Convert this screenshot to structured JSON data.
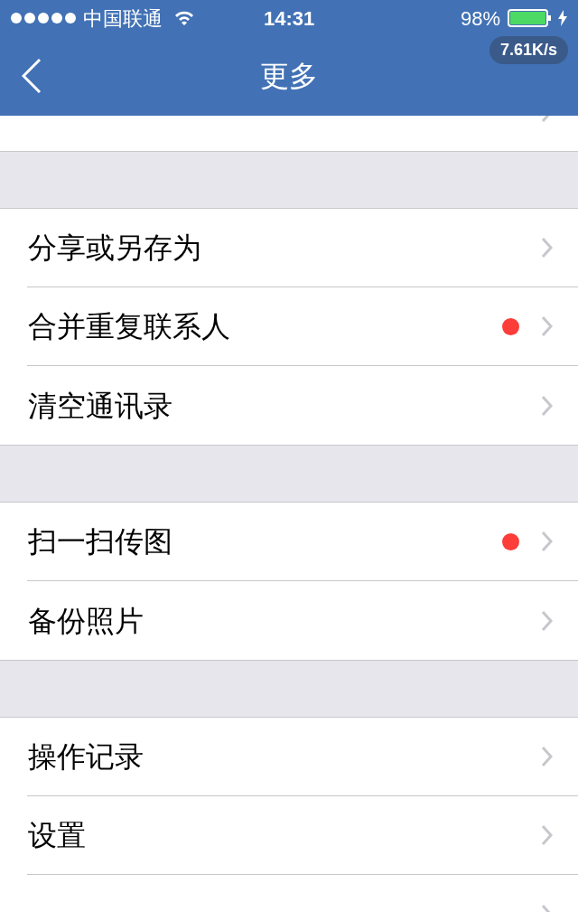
{
  "status_bar": {
    "carrier": "中国联通",
    "time": "14:31",
    "battery": "98%",
    "speed": "7.61K/s"
  },
  "nav": {
    "title": "更多"
  },
  "sections": [
    {
      "items": [
        {
          "badge": false
        }
      ]
    },
    {
      "items": [
        {
          "label": "分享或另存为",
          "badge": false
        },
        {
          "label": "合并重复联系人",
          "badge": true
        },
        {
          "label": "清空通讯录",
          "badge": false
        }
      ]
    },
    {
      "items": [
        {
          "label": "扫一扫传图",
          "badge": true
        },
        {
          "label": "备份照片",
          "badge": false
        }
      ]
    },
    {
      "items": [
        {
          "label": "操作记录",
          "badge": false
        },
        {
          "label": "设置",
          "badge": false
        },
        {
          "badge": false
        }
      ]
    }
  ]
}
